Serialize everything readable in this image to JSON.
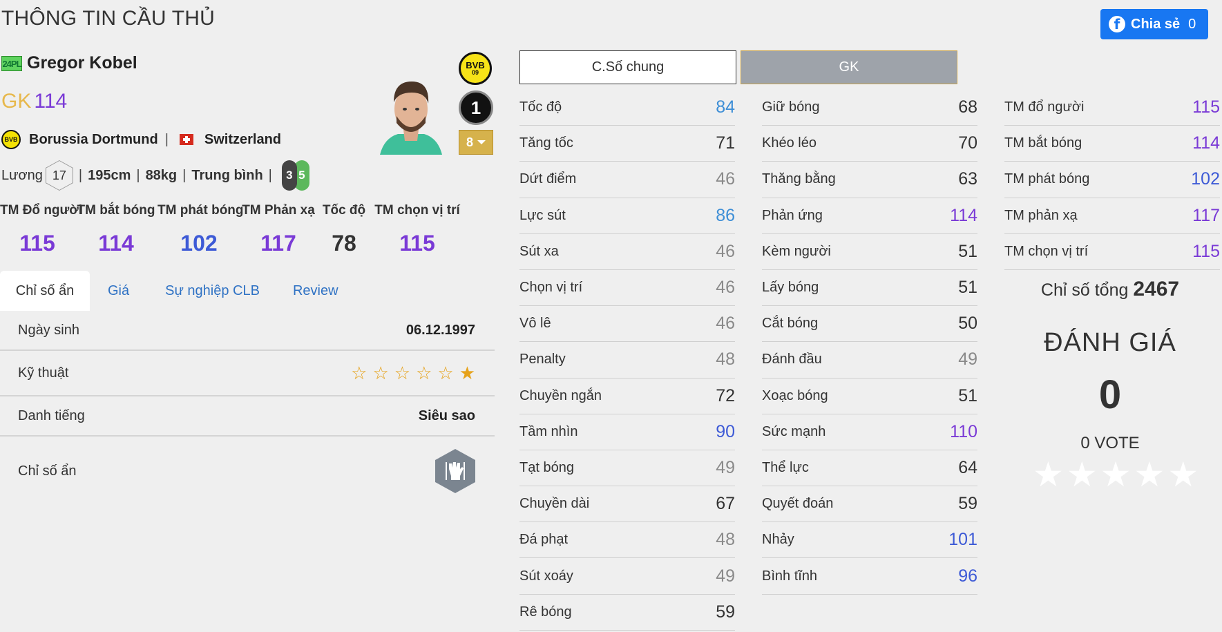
{
  "page": {
    "title": "THÔNG TIN CẦU THỦ"
  },
  "share": {
    "label": "Chia sẻ",
    "count": "0",
    "icon": "facebook-icon",
    "color": "#1877f2"
  },
  "player": {
    "season": "24PL",
    "name": "Gregor Kobel",
    "position": "GK",
    "ovr": "114",
    "club": "Borussia Dortmund",
    "club_logo_text": "BVB",
    "club_logo_sub": "09",
    "nation": "Switzerland",
    "salary_label": "Lương",
    "salary": "17",
    "height": "195cm",
    "weight": "88kg",
    "body_type": "Trung bình",
    "foot_left": "3",
    "foot_right": "5",
    "jersey_number": "1",
    "upgrade_level": "8"
  },
  "traits": [
    {
      "label": "TM Đổ người",
      "value": "115",
      "color": "#7a3ad6"
    },
    {
      "label": "TM bắt bóng",
      "value": "114",
      "color": "#7a3ad6"
    },
    {
      "label": "TM phát bóng",
      "value": "102",
      "color": "#3d5ad6"
    },
    {
      "label": "TM Phản xạ",
      "value": "117",
      "color": "#7a3ad6"
    },
    {
      "label": "Tốc độ",
      "value": "78",
      "color": "#333333"
    },
    {
      "label": "TM chọn vị trí",
      "value": "115",
      "color": "#7a3ad6"
    }
  ],
  "tabs": [
    "Chỉ số ẩn",
    "Giá",
    "Sự nghiệp CLB",
    "Review"
  ],
  "details": {
    "birth_label": "Ngày sinh",
    "birth": "06.12.1997",
    "skill_label": "Kỹ thuật",
    "skill_stars": 1,
    "skill_max": 6,
    "fame_label": "Danh tiếng",
    "fame": "Siêu sao",
    "hidden_label": "Chỉ số ẩn",
    "hidden_icon": "goalkeeper-glove-icon"
  },
  "stat_tabs": {
    "common": "C.Số chung",
    "gk": "GK"
  },
  "stats_col1": [
    {
      "label": "Tốc độ",
      "value": "84",
      "tone": "blue"
    },
    {
      "label": "Tăng tốc",
      "value": "71",
      "tone": "dark"
    },
    {
      "label": "Dứt điểm",
      "value": "46",
      "tone": "gray"
    },
    {
      "label": "Lực sút",
      "value": "86",
      "tone": "blue"
    },
    {
      "label": "Sút xa",
      "value": "46",
      "tone": "gray"
    },
    {
      "label": "Chọn vị trí",
      "value": "46",
      "tone": "gray"
    },
    {
      "label": "Vô lê",
      "value": "46",
      "tone": "gray"
    },
    {
      "label": "Penalty",
      "value": "48",
      "tone": "gray"
    },
    {
      "label": "Chuyền ngắn",
      "value": "72",
      "tone": "dark"
    },
    {
      "label": "Tầm nhìn",
      "value": "90",
      "tone": "indigo"
    },
    {
      "label": "Tạt bóng",
      "value": "49",
      "tone": "gray"
    },
    {
      "label": "Chuyền dài",
      "value": "67",
      "tone": "dark"
    },
    {
      "label": "Đá phạt",
      "value": "48",
      "tone": "gray"
    },
    {
      "label": "Sút xoáy",
      "value": "49",
      "tone": "gray"
    },
    {
      "label": "Rê bóng",
      "value": "59",
      "tone": "dark"
    }
  ],
  "stats_col2": [
    {
      "label": "Giữ bóng",
      "value": "68",
      "tone": "dark"
    },
    {
      "label": "Khéo léo",
      "value": "70",
      "tone": "dark"
    },
    {
      "label": "Thăng bằng",
      "value": "63",
      "tone": "dark"
    },
    {
      "label": "Phản ứng",
      "value": "114",
      "tone": "purple"
    },
    {
      "label": "Kèm người",
      "value": "51",
      "tone": "dark"
    },
    {
      "label": "Lấy bóng",
      "value": "51",
      "tone": "dark"
    },
    {
      "label": "Cắt bóng",
      "value": "50",
      "tone": "dark"
    },
    {
      "label": "Đánh đầu",
      "value": "49",
      "tone": "gray"
    },
    {
      "label": "Xoạc bóng",
      "value": "51",
      "tone": "dark"
    },
    {
      "label": "Sức mạnh",
      "value": "110",
      "tone": "purple"
    },
    {
      "label": "Thể lực",
      "value": "64",
      "tone": "dark"
    },
    {
      "label": "Quyết đoán",
      "value": "59",
      "tone": "dark"
    },
    {
      "label": "Nhảy",
      "value": "101",
      "tone": "indigo"
    },
    {
      "label": "Bình tĩnh",
      "value": "96",
      "tone": "indigo"
    }
  ],
  "stats_col3": [
    {
      "label": "TM đổ người",
      "value": "115",
      "tone": "purple"
    },
    {
      "label": "TM bắt bóng",
      "value": "114",
      "tone": "purple"
    },
    {
      "label": "TM phát bóng",
      "value": "102",
      "tone": "indigo"
    },
    {
      "label": "TM phản xạ",
      "value": "117",
      "tone": "purple"
    },
    {
      "label": "TM chọn vị trí",
      "value": "115",
      "tone": "purple"
    }
  ],
  "summary": {
    "total_label": "Chỉ số tổng",
    "total": "2467",
    "rating_title": "ĐÁNH GIÁ",
    "rating_value": "0",
    "votes": "0 VOTE",
    "vote_stars": 5
  }
}
